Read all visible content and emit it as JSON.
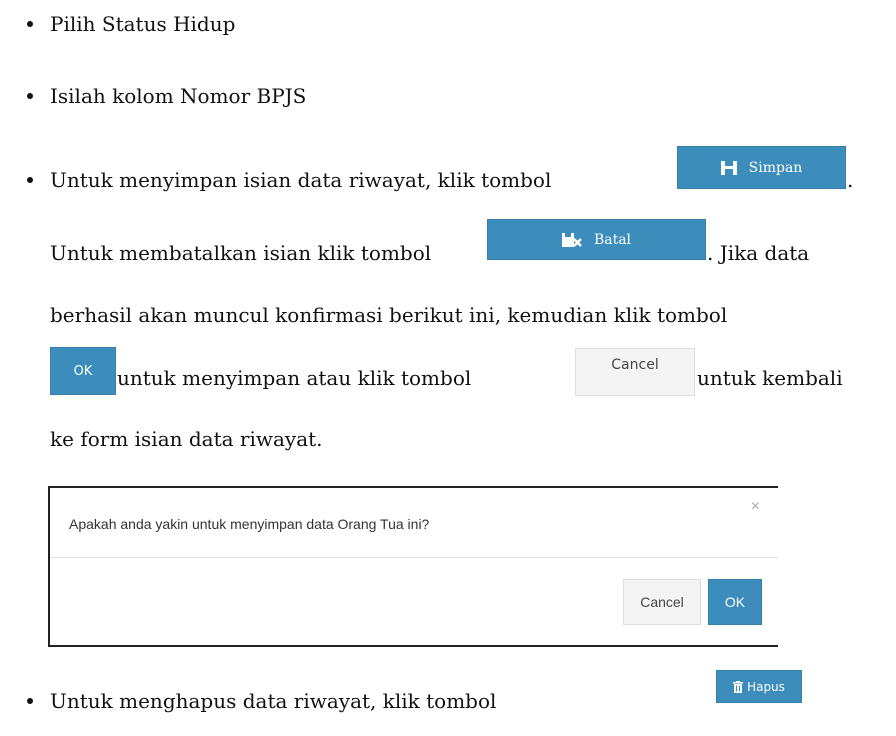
{
  "items": {
    "status_hidup": "Pilih Status Hidup",
    "nomor_bpjs": "Isilah kolom Nomor BPJS",
    "simpan_intro": "Untuk menyimpan isian data riwayat, klik tombol",
    "simpan_after": ".",
    "batal_intro": "Untuk membatalkan isian klik tombol",
    "batal_after": ". Jika data",
    "line_berhasil": "berhasil akan muncul konfirmasi berikut ini, kemudian klik tombol",
    "ok_after": "untuk menyimpan atau klik tombol",
    "cancel_after": "untuk kembali",
    "line_kembali": "ke form isian data riwayat.",
    "hapus_intro": "Untuk menghapus data riwayat, klik tombol"
  },
  "buttons": {
    "simpan": "Simpan",
    "batal": "Batal",
    "ok": "OK",
    "cancel": "Cancel",
    "hapus": "Hapus"
  },
  "modal": {
    "message": "Apakah anda yakin untuk menyimpan data Orang Tua ini?",
    "close": "×",
    "cancel_label": "Cancel",
    "ok_label": "OK"
  },
  "icons": {
    "simpan": "floppy-disk-icon",
    "batal": "cancel-save-icon",
    "hapus": "trash-icon"
  },
  "colors": {
    "primary_button": "#3c8dbc",
    "default_button": "#f4f4f4"
  }
}
